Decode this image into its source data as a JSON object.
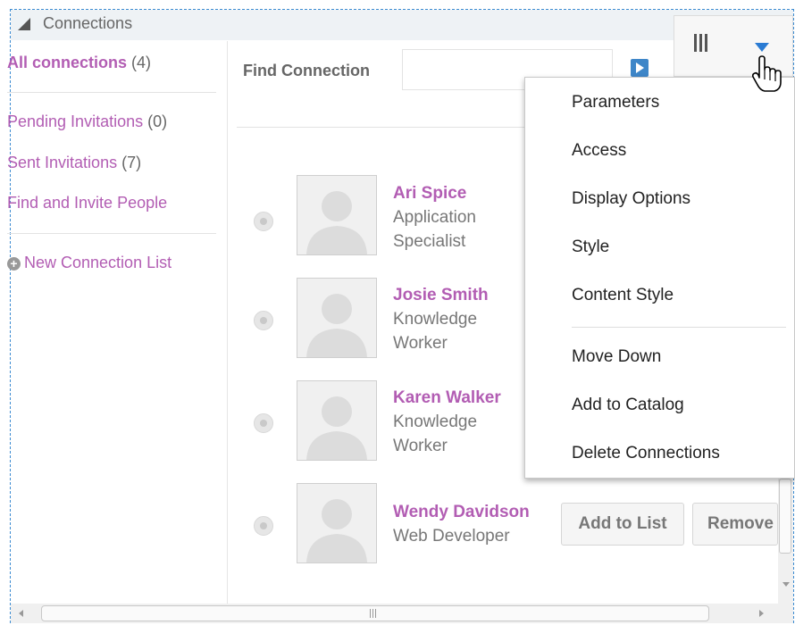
{
  "panel": {
    "title": "Connections"
  },
  "sidebar": {
    "items": [
      {
        "label": "All connections",
        "count": "(4)"
      },
      {
        "label": "Pending Invitations",
        "count": "(0)"
      },
      {
        "label": "Sent Invitations",
        "count": "(7)"
      },
      {
        "label": "Find and Invite People",
        "count": ""
      }
    ],
    "new_list_label": "New Connection List"
  },
  "search": {
    "label": "Find Connection",
    "value": "",
    "placeholder": ""
  },
  "connections": [
    {
      "name": "Ari Spice",
      "role_line1": "Application",
      "role_line2": "Specialist"
    },
    {
      "name": "Josie Smith",
      "role_line1": "Knowledge",
      "role_line2": "Worker"
    },
    {
      "name": "Karen Walker",
      "role_line1": "Knowledge",
      "role_line2": "Worker"
    },
    {
      "name": "Wendy Davidson",
      "role_line1": "Web Developer",
      "role_line2": ""
    }
  ],
  "row_actions": {
    "add_to_list": "Add to List",
    "remove": "Remove"
  },
  "menu": {
    "items": [
      "Parameters",
      "Access",
      "Display Options",
      "Style",
      "Content Style",
      "Move Down",
      "Add to Catalog",
      "Delete Connections"
    ]
  },
  "colors": {
    "link": "#b25db3",
    "accent": "#2a7bd3",
    "frame": "#3c8bd1"
  }
}
